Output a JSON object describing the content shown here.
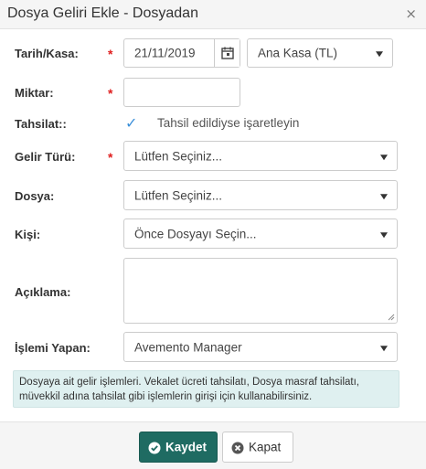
{
  "dialog": {
    "title": "Dosya Geliri Ekle - Dosyadan",
    "close_glyph": "×"
  },
  "form": {
    "required_mark": "*",
    "date_label": "Tarih/Kasa:",
    "date_value": "21/11/2019",
    "cashbox_value": "Ana Kasa (TL)",
    "amount_label": "Miktar:",
    "amount_value": "",
    "collection_label": "Tahsilat::",
    "collection_checked": true,
    "collection_check_glyph": "✓",
    "collection_text": "Tahsil edildiyse işaretleyin",
    "income_type_label": "Gelir Türü:",
    "income_type_value": "Lütfen Seçiniz...",
    "file_label": "Dosya:",
    "file_value": "Lütfen Seçiniz...",
    "person_label": "Kişi:",
    "person_value": "Önce Dosyayı Seçin...",
    "description_label": "Açıklama:",
    "description_value": "",
    "operator_label": "İşlemi Yapan:",
    "operator_value": "Avemento Manager",
    "info_text": "Dosyaya ait gelir işlemleri. Vekalet ücreti tahsilatı, Dosya masraf tahsilatı, müvekkil adına tahsilat gibi işlemlerin girişi için kullanabilirsiniz."
  },
  "footer": {
    "save_label": "Kaydet",
    "close_label": "Kapat"
  },
  "icons": {
    "calendar": "calendar-icon",
    "dropdown": "caret-down-icon",
    "save": "check-circle-icon",
    "close": "times-circle-icon"
  },
  "colors": {
    "save_button": "#1f6b62",
    "required": "#e02020",
    "checkbox": "#3b8fd9",
    "info_bg": "#dff0f0"
  }
}
